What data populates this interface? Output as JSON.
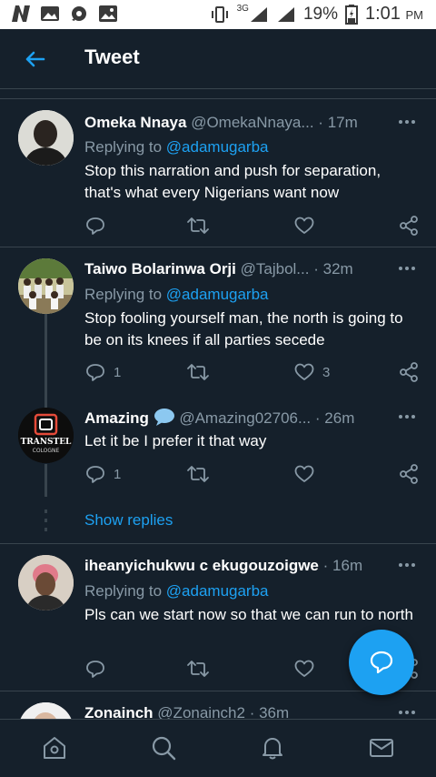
{
  "status_bar": {
    "network": "3G",
    "battery": "19%",
    "time": "1:01",
    "ampm": "PM"
  },
  "header": {
    "title": "Tweet"
  },
  "tweets": [
    {
      "name": "Omeka Nnaya",
      "handle": "@OmekaNnaya...",
      "time": "17m",
      "replying_label": "Replying to ",
      "replying_to": "@adamugarba",
      "text": "Stop this narration and push for separation, that's what every Nigerians want now",
      "replies": "",
      "likes": ""
    },
    {
      "name": "Taiwo Bolarinwa Orji",
      "handle": "@Tajbol...",
      "time": "32m",
      "replying_label": "Replying to ",
      "replying_to": "@adamugarba",
      "text": "Stop fooling yourself man, the north is going to be on its knees if all parties secede",
      "replies": "1",
      "likes": "3"
    },
    {
      "name": "Amazing",
      "handle": "@Amazing02706...",
      "time": "26m",
      "text": "Let it be I prefer it that way",
      "replies": "1",
      "likes": "",
      "avatar_text": "TRANSTEL",
      "avatar_subtext": "COLOGNE"
    },
    {
      "name": "iheanyichukwu c ekugouzoigwe",
      "handle": "",
      "time": "16m",
      "replying_label": "Replying to ",
      "replying_to": "@adamugarba",
      "text": "Pls can we start now so that we can run to north",
      "replies": "",
      "likes": ""
    },
    {
      "name": "Zonainch",
      "handle": "@Zonainch2",
      "time": "36m"
    }
  ],
  "show_replies": "Show replies",
  "separator": "·",
  "colors": {
    "background": "#15202b",
    "accent": "#1da1f2",
    "secondary_text": "#8899a6",
    "divider": "#38444d"
  },
  "icons": {
    "back": "back-arrow-icon",
    "reply": "reply-icon",
    "retweet": "retweet-icon",
    "like": "heart-icon",
    "share": "share-icon",
    "compose": "compose-reply-icon",
    "nav": [
      "home-icon",
      "search-icon",
      "notifications-icon",
      "messages-icon"
    ]
  }
}
